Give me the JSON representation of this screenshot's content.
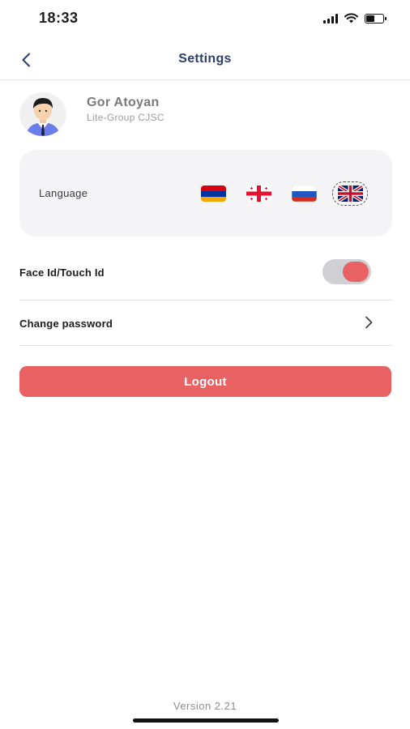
{
  "status_bar": {
    "time": "18:33",
    "icons": [
      "signal-icon",
      "wifi-icon",
      "battery-icon"
    ],
    "battery_level": 0.55
  },
  "nav": {
    "title": "Settings",
    "back_icon": "chevron-left-icon"
  },
  "profile": {
    "name": "Gor Atoyan",
    "company": "Lite-Group CJSC"
  },
  "language": {
    "label": "Language",
    "options": [
      {
        "code": "hy",
        "icon": "armenia-flag-icon",
        "selected": false
      },
      {
        "code": "ka",
        "icon": "georgia-flag-icon",
        "selected": false
      },
      {
        "code": "ru",
        "icon": "russia-flag-icon",
        "selected": false
      },
      {
        "code": "en",
        "icon": "uk-flag-icon",
        "selected": true
      }
    ]
  },
  "face_id": {
    "label": "Face Id/Touch Id",
    "enabled": true
  },
  "change_password": {
    "label": "Change password",
    "icon": "chevron-right-icon"
  },
  "logout": {
    "label": "Logout"
  },
  "footer": {
    "version": "Version 2.21"
  },
  "colors": {
    "accent": "#e86163",
    "title": "#2d3e6b",
    "card_bg": "#f4f4f6"
  }
}
